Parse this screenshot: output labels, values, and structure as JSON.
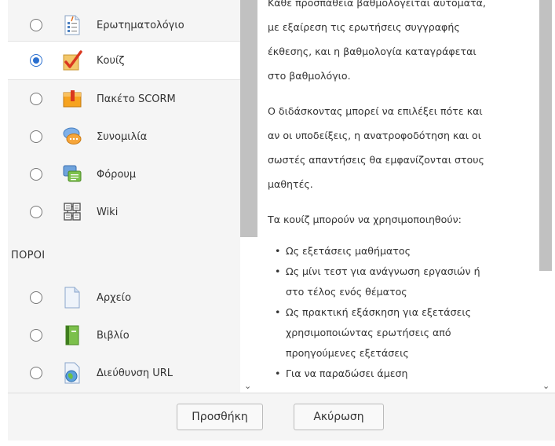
{
  "activities": [
    {
      "label": "Ερωτηματολόγιο",
      "icon": "questionnaire-icon",
      "selected": false
    },
    {
      "label": "Κουίζ",
      "icon": "quiz-checkmark-icon",
      "selected": true
    },
    {
      "label": "Πακέτο SCORM",
      "icon": "scorm-package-icon",
      "selected": false
    },
    {
      "label": "Συνομιλία",
      "icon": "chat-bubble-icon",
      "selected": false
    },
    {
      "label": "Φόρουμ",
      "icon": "forum-icon",
      "selected": false
    },
    {
      "label": "Wiki",
      "icon": "wiki-icon",
      "selected": false
    }
  ],
  "resources_heading": "ΠΟΡΟΙ",
  "resources": [
    {
      "label": "Αρχείο",
      "icon": "file-icon",
      "selected": false
    },
    {
      "label": "Βιβλίο",
      "icon": "book-icon",
      "selected": false
    },
    {
      "label": "Διεύθυνση URL",
      "icon": "url-globe-icon",
      "selected": false
    }
  ],
  "description": {
    "lines_top": [
      "Κάθε προσπάθεια βαθμολογείται αυτόματα,",
      "με εξαίρεση τις ερωτήσεις συγγραφής",
      "έκθεσης, και η βαθμολογία καταγράφεται",
      "στο βαθμολόγιο."
    ],
    "lines_mid": [
      "Ο διδάσκοντας μπορεί να επιλέξει πότε και",
      "αν οι υποδείξεις, η ανατροφοδότηση και οι",
      "σωστές απαντήσεις θα εμφανίζονται στους",
      "μαθητές."
    ],
    "uses_intro": "Τα κουίζ μπορούν να χρησιμοποιηθούν:",
    "bullets": [
      [
        "Ως εξετάσεις μαθήματος"
      ],
      [
        "Ως μίνι τεστ για ανάγνωση εργασιών ή",
        "στο τέλος ενός θέματος"
      ],
      [
        "Ως πρακτική εξάσκηση για εξετάσεις",
        "χρησιμοποιώντας ερωτήσεις από",
        "προηγούμενες εξετάσεις"
      ],
      [
        "Για να παραδώσει άμεση"
      ]
    ]
  },
  "buttons": {
    "add": "Προσθήκη",
    "cancel": "Ακύρωση"
  },
  "colors": {
    "accent": "#2a6fcf",
    "panel_bg": "#f5f5f5",
    "scroll_thumb": "#c1c1c1"
  }
}
